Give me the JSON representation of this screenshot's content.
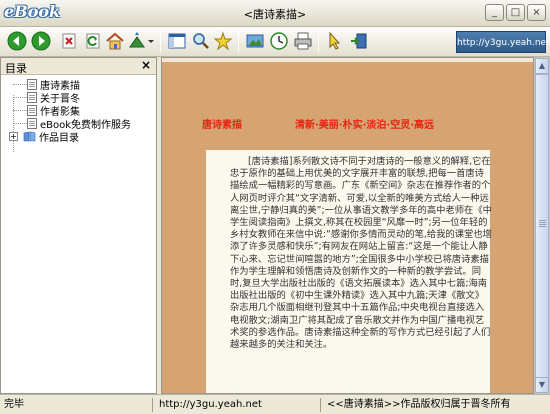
{
  "window": {
    "logo": "eBook",
    "title": "<唐诗素描>",
    "url_badge": "http://y3gu.yeah.net",
    "controls": [
      "_",
      "□",
      "×"
    ]
  },
  "toolbar": {
    "buttons": [
      "back-icon",
      "forward-icon",
      "stop-icon",
      "refresh-icon",
      "home-icon",
      "upload-icon",
      "panel-icon",
      "search-icon",
      "favorite-icon",
      "image-icon",
      "history-icon",
      "print-icon",
      "pointer-icon",
      "exit-icon"
    ]
  },
  "sidebar": {
    "title": "目录",
    "close": "×",
    "items": [
      {
        "label": "唐诗素描"
      },
      {
        "label": "关于晋冬"
      },
      {
        "label": "作者影集"
      },
      {
        "label": "eBook免费制作服务"
      },
      {
        "label": "作品目录"
      }
    ]
  },
  "content": {
    "heading_left": "唐诗素描",
    "heading_right": "清新·美丽·朴实·淡泊·空灵·高远",
    "body": "[唐诗素描]系列散文诗不同于对唐诗的一般意义的解释,它在忠于原作的基础上用优美的文字展开丰富的联想,把每一首唐诗描绘成一幅精彩的写意画。广东《新空间》杂志在推荐作者的个人网页时评介其“文字清新、可爱,以全新的唯美方式给人一种远离尘世,宁静归真的美”;一位从事语文教学多年的高中老师在《中学生阅读指南》上撰文,称其在校园里“风靡一时”;另一位年轻的乡村女教师在来信中说:“感谢你多情而灵动的笔,给我的课堂也增添了许多灵感和快乐”;有网友在网站上留言:“这是一个能让人静下心来、忘记世间喧嚣的地方”;全国很多中小学校已将唐诗素描作为学生理解和领悟唐诗及创新作文的一种新的教学尝试。同时,复旦大学出版社出版的《语文拓展读本》选入其中七篇;海南出版社出版的《初中生课外精读》选入其中九篇;天津《散文》杂志用几个版面相继刊登其中十五篇作品;中央电视台直接选入电视散文;湖南卫广将其配成了音乐散文并作为中国广播电视艺术奖的参选作品。唐诗素描这种全新的写作方式已经引起了人们越来越多的关注和关注。"
  },
  "status": {
    "left": "完毕",
    "middle": "http://y3gu.yeah.net",
    "right": "<<唐诗素描>>作品版权归属于晋冬所有"
  }
}
